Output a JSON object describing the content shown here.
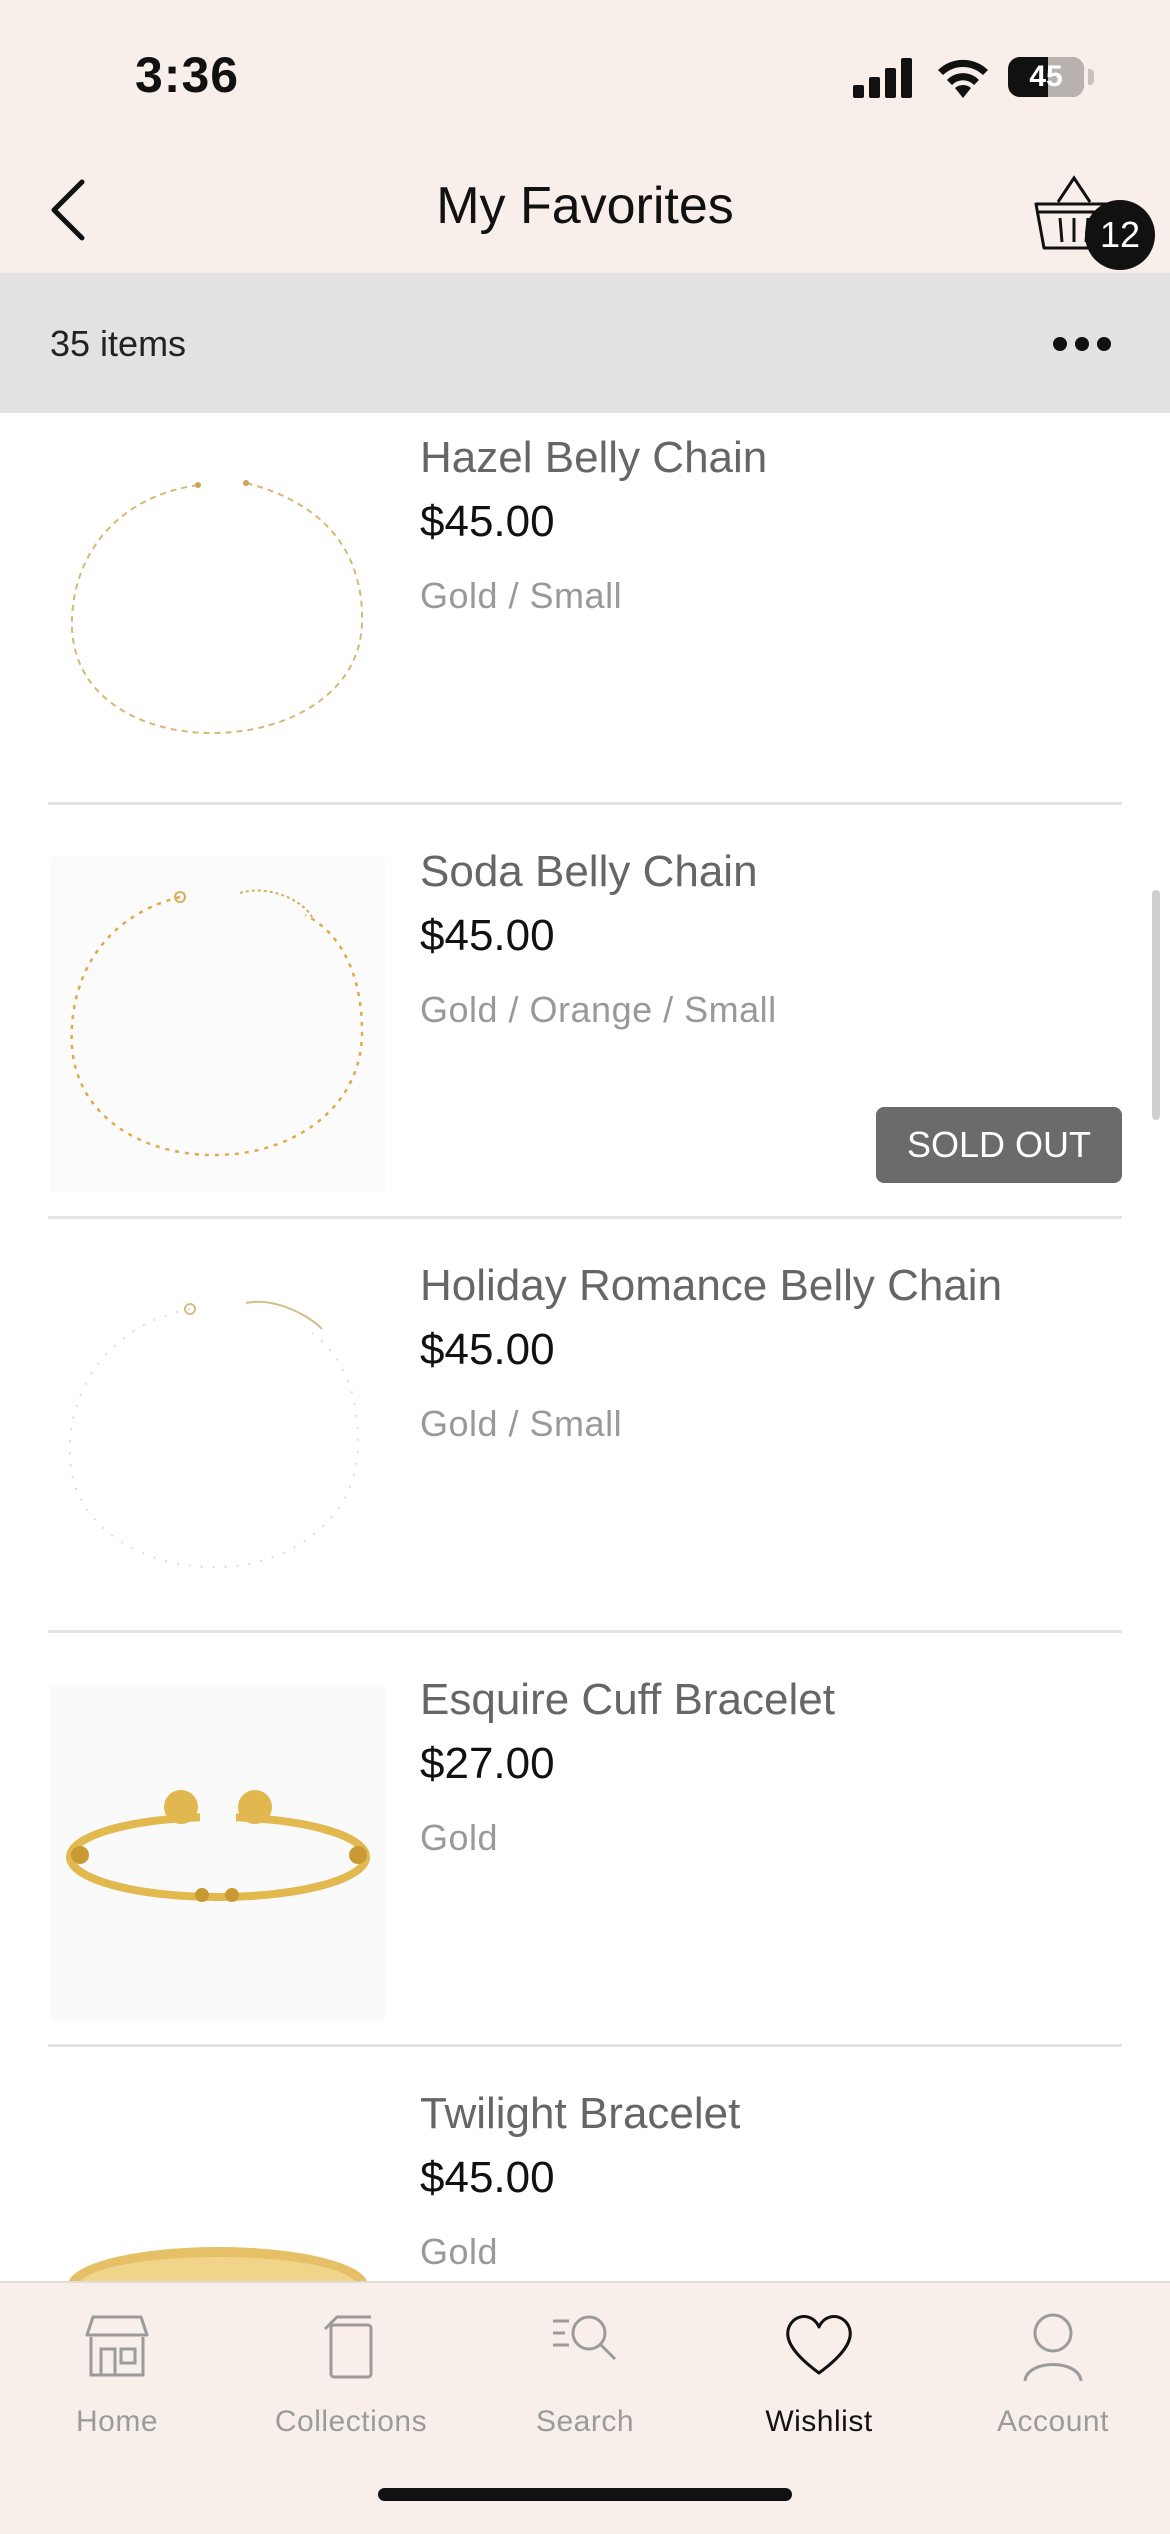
{
  "status_bar": {
    "time": "3:36",
    "battery": "45"
  },
  "header": {
    "title": "My Favorites",
    "cart_count": "12"
  },
  "subheader": {
    "item_count": "35 items"
  },
  "items": [
    {
      "name": "Hazel Belly Chain",
      "price": "$45.00",
      "variant": "Gold / Small"
    },
    {
      "name": "Soda Belly Chain",
      "price": "$45.00",
      "variant": "Gold / Orange / Small"
    },
    {
      "name": "Holiday Romance Belly Chain",
      "price": "$45.00",
      "variant": "Gold / Small",
      "badge": "SOLD OUT"
    },
    {
      "name": "Esquire Cuff Bracelet",
      "price": "$27.00",
      "variant": "Gold"
    },
    {
      "name": "Twilight Bracelet",
      "price": "$45.00",
      "variant": "Gold"
    }
  ],
  "tabs": [
    {
      "label": "Home",
      "icon": "store-icon"
    },
    {
      "label": "Collections",
      "icon": "collections-icon"
    },
    {
      "label": "Search",
      "icon": "search-icon"
    },
    {
      "label": "Wishlist",
      "icon": "heart-icon",
      "active": true
    },
    {
      "label": "Account",
      "icon": "user-icon"
    }
  ],
  "colors": {
    "header_bg": "#f8efea",
    "subheader_bg": "#e2e2e2",
    "sold_out_bg": "#6b6b6b",
    "gold": "#d9b44a"
  }
}
